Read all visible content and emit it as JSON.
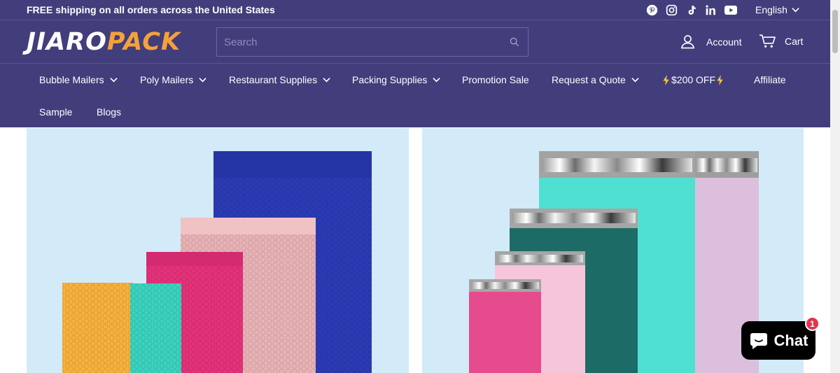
{
  "announcement": {
    "text": "FREE shipping on all orders across the United States"
  },
  "social": [
    "pinterest-icon",
    "instagram-icon",
    "tiktok-icon",
    "linkedin-icon",
    "youtube-icon"
  ],
  "language": {
    "label": "English"
  },
  "header": {
    "logo_part1": "JIARO",
    "logo_part2": "PACK",
    "search_placeholder": "Search",
    "account_label": "Account",
    "cart_label": "Cart"
  },
  "nav": {
    "items": [
      {
        "label": "Bubble Mailers",
        "dropdown": true
      },
      {
        "label": "Poly Mailers",
        "dropdown": true
      },
      {
        "label": "Restaurant Supplies",
        "dropdown": true
      },
      {
        "label": "Packing Supplies",
        "dropdown": true
      },
      {
        "label": "Promotion Sale",
        "dropdown": false
      },
      {
        "label": "Request a Quote",
        "dropdown": true
      },
      {
        "label": "$200 OFF",
        "dropdown": false
      },
      {
        "label": "Affiliate",
        "dropdown": false
      },
      {
        "label": "Sample",
        "dropdown": false
      },
      {
        "label": "Blogs",
        "dropdown": false
      }
    ]
  },
  "chat": {
    "label": "Chat",
    "badge": "1"
  },
  "colors": {
    "brand": "#423e7c",
    "accent": "#f5a13a",
    "tile_bg": "#d3eaf8",
    "badge": "#e2334f"
  }
}
